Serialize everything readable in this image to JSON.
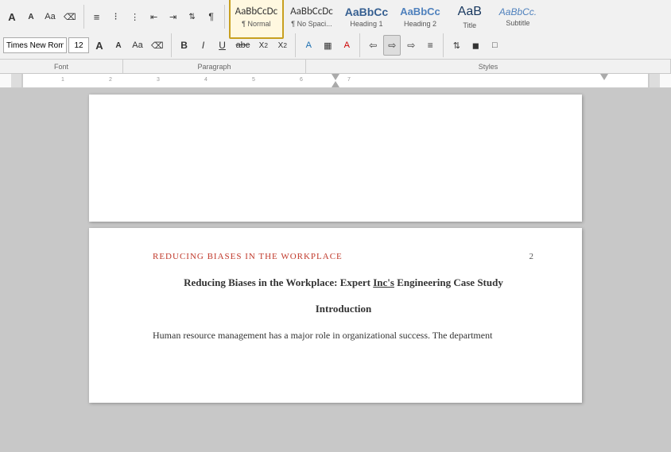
{
  "toolbar": {
    "font_name": "Times New Roman",
    "font_size": "12",
    "section_font": "Font",
    "section_paragraph": "Paragraph",
    "section_styles": "Styles"
  },
  "styles": {
    "normal_label": "¶ Normal",
    "no_spacing_label": "¶ No Spaci...",
    "h1_label": "Heading 1",
    "h2_label": "Heading 2",
    "title_label": "Title",
    "subtitle_label": "Subtitle",
    "normal_preview": "AaBbCcDc",
    "no_spacing_preview": "AaBbCcDc",
    "h1_preview": "AaBbCc",
    "h2_preview": "AaBbCc",
    "title_preview": "AaB",
    "subtitle_preview": "AaBbCc."
  },
  "document": {
    "page2_header": "REDUCING BIASES IN THE WORKPLACE",
    "page2_number": "2",
    "doc_title": "Reducing Biases in the Workplace: Expert Inc's Engineering Case Study",
    "section_title": "Introduction",
    "body_text": "Human resource management has a major role in organizational success. The department"
  }
}
